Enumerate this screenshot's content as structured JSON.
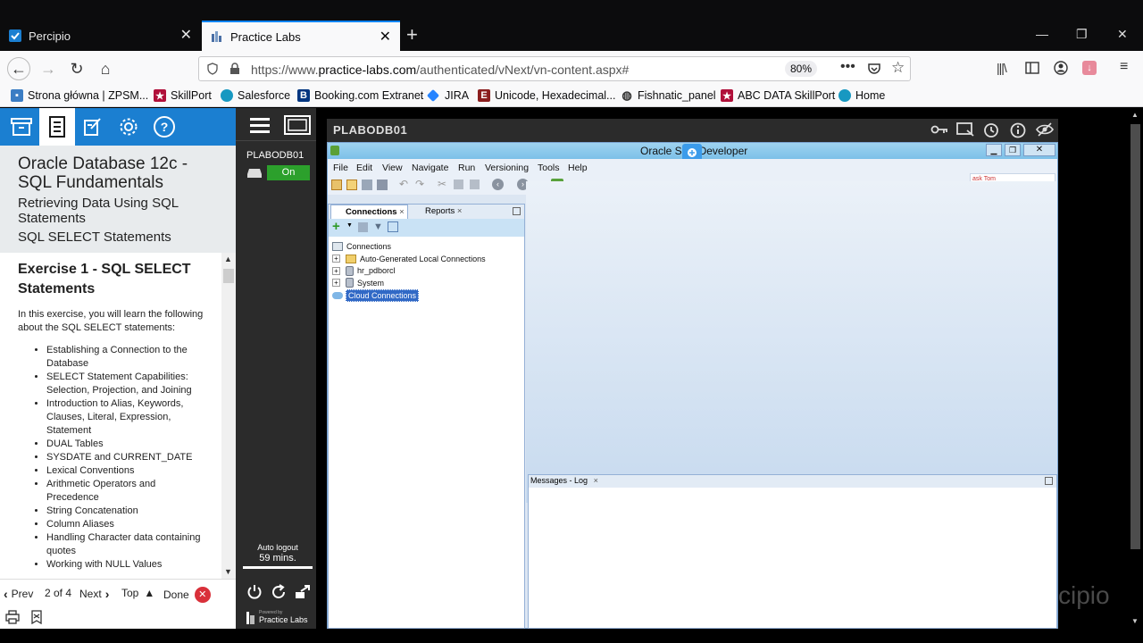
{
  "browser": {
    "tabs": [
      {
        "title": "Percipio",
        "active": false
      },
      {
        "title": "Practice Labs",
        "active": true
      }
    ],
    "url": {
      "prefix": "https://www.",
      "domain": "practice-labs.com",
      "path": "/authenticated/vNext/vn-content.aspx#"
    },
    "zoom": "80%",
    "bookmarks": [
      {
        "label": "Strona główna | ZPSM...",
        "icon": "bookmark-icon"
      },
      {
        "label": "SkillPort",
        "icon": "skillport-icon"
      },
      {
        "label": "Salesforce",
        "icon": "salesforce-icon"
      },
      {
        "label": "Booking.com Extranet",
        "icon": "booking-icon"
      },
      {
        "label": "JIRA",
        "icon": "jira-icon"
      },
      {
        "label": "Unicode, Hexadecimal...",
        "icon": "unicode-icon"
      },
      {
        "label": "Fishnatic_panel",
        "icon": "globe-icon"
      },
      {
        "label": "ABC DATA SkillPort",
        "icon": "skillport-icon"
      },
      {
        "label": "Home",
        "icon": "salesforce-icon"
      }
    ]
  },
  "course": {
    "title": "Oracle Database 12c - SQL Fundamentals",
    "lesson": "Retrieving Data Using SQL Statements",
    "topic": "SQL SELECT Statements",
    "exercise_title": "Exercise 1 - SQL SELECT Statements",
    "intro": "In this exercise, you will learn the following about the SQL SELECT statements:",
    "items": [
      "Establishing a Connection to the Database",
      "SELECT Statement Capabilities: Selection, Projection, and Joining",
      "Introduction to Alias, Keywords, Clauses, Literal, Expression, Statement",
      "DUAL Tables",
      "SYSDATE and CURRENT_DATE",
      "Lexical Conventions",
      "Arithmetic Operators and Precedence",
      "String Concatenation",
      "Column Aliases",
      "Handling Character data containing quotes",
      "Working with NULL Values"
    ],
    "pager": {
      "prev": "Prev",
      "position": "2 of 4",
      "next": "Next",
      "top": "Top",
      "done": "Done"
    }
  },
  "rail": {
    "device": "PLABODB01",
    "power_state": "On",
    "autologout_label": "Auto logout",
    "autologout_time": "59 mins.",
    "brand_small": "Powered by",
    "brand": "Practice Labs"
  },
  "vm": {
    "name": "PLABODB01",
    "app_title": "Oracle SQL Developer",
    "menus": [
      "File",
      "Edit",
      "View",
      "Navigate",
      "Run",
      "Versioning",
      "Tools",
      "Help"
    ],
    "panel_tabs": [
      "Connections",
      "Reports"
    ],
    "tree": [
      {
        "label": "Connections",
        "level": 0,
        "icon": "connections-icon"
      },
      {
        "label": "Auto-Generated Local Connections",
        "level": 1,
        "icon": "folder-icon"
      },
      {
        "label": "hr_pdborcl",
        "level": 1,
        "icon": "database-icon"
      },
      {
        "label": "System",
        "level": 1,
        "icon": "database-icon"
      },
      {
        "label": "Cloud Connections",
        "level": 0,
        "icon": "cloud-icon",
        "selected": true
      }
    ],
    "search_hint": "ask Tom",
    "messages_tab": "Messages - Log"
  },
  "watermark": "cipio"
}
